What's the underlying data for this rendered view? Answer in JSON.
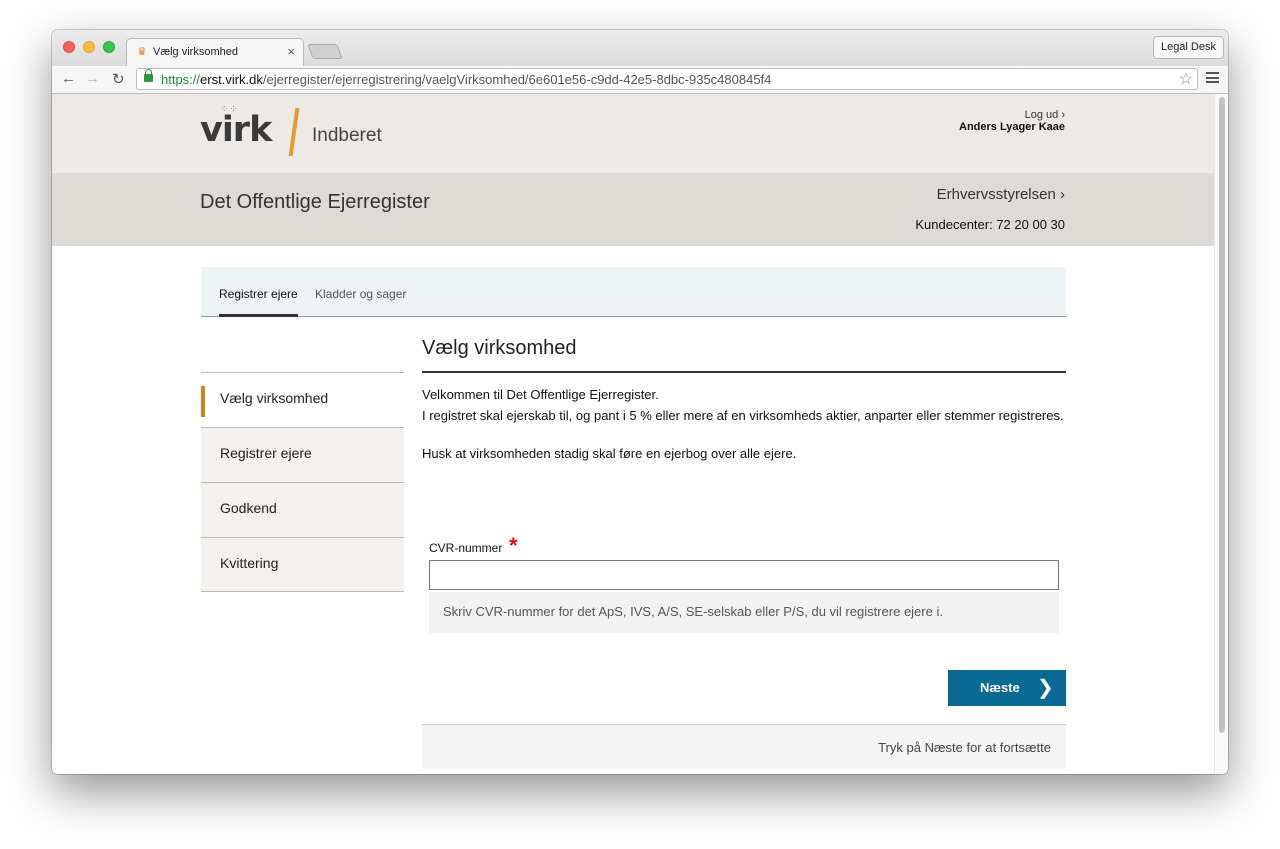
{
  "browser": {
    "tab_title": "Vælg virksomhed",
    "tab_close": "×",
    "extension_button": "Legal Desk",
    "url_scheme": "https://",
    "url_host": "erst.virk.dk",
    "url_path": "/ejerregister/ejerregistrering/vaelgVirksomhed/6e601e56-c9dd-42e5-8dbc-935c480845f4"
  },
  "header": {
    "logo_text": "virk",
    "logo_sub": "Indberet",
    "logout": "Log ud ›",
    "user_name": "Anders Lyager Kaae",
    "site_title": "Det Offentlige Ejerregister",
    "agency_link": "Erhvervsstyrelsen ›",
    "customer_center": "Kundecenter: 72 20 00 30"
  },
  "tabs": [
    {
      "label": "Registrer ejere",
      "active": true
    },
    {
      "label": "Kladder og sager",
      "active": false
    }
  ],
  "sidebar": {
    "items": [
      {
        "label": "Vælg virksomhed",
        "active": true
      },
      {
        "label": "Registrer ejere",
        "active": false
      },
      {
        "label": "Godkend",
        "active": false
      },
      {
        "label": "Kvittering",
        "active": false
      }
    ]
  },
  "main": {
    "heading": "Vælg virksomhed",
    "intro_line1": "Velkommen til Det Offentlige Ejerregister.",
    "intro_line2": "I registret skal ejerskab til, og pant i 5 % eller mere af en virksomheds aktier, anparter eller stemmer registreres.",
    "reminder": "Husk at virksomheden stadig skal føre en ejerbog over alle ejere.",
    "cvr_label": "CVR-nummer",
    "required_mark": "*",
    "cvr_value": "",
    "cvr_help": "Skriv CVR-nummer for det ApS, IVS, A/S, SE-selskab eller P/S, du vil registrere ejere i.",
    "next_button": "Næste",
    "footer_hint": "Tryk på Næste for at fortsætte"
  },
  "colors": {
    "accent_orange": "#e89a2c",
    "button_blue": "#0a6a96",
    "required_red": "#dd1111"
  }
}
